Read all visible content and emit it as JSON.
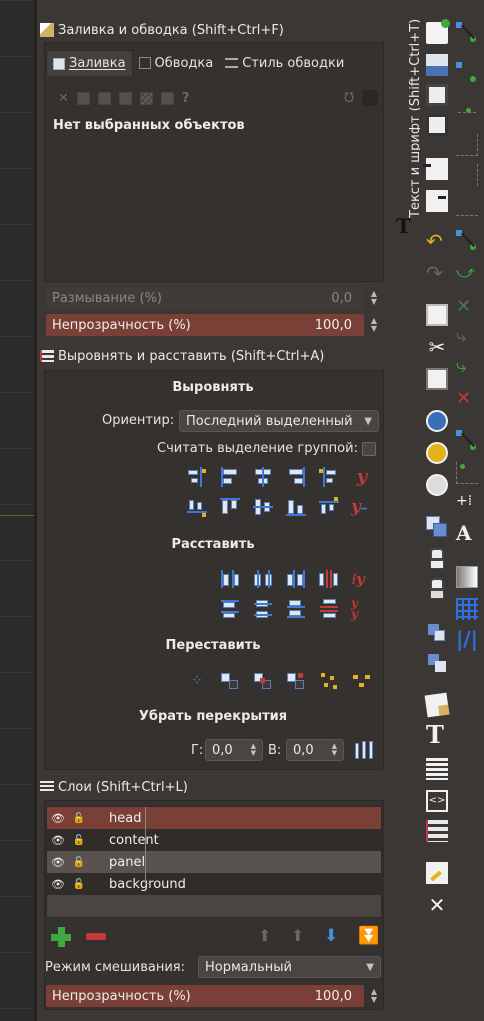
{
  "fill_stroke": {
    "title": "Заливка и обводка (Shift+Ctrl+F)",
    "tabs": [
      {
        "label": "Заливка",
        "underline": "З"
      },
      {
        "label": "Обводка",
        "underline": "б"
      },
      {
        "label": "Стиль обводки",
        "underline": "С"
      }
    ],
    "no_selection": "Нет выбранных объектов",
    "blur_label": "Размывание (%)",
    "blur_value": "0,0",
    "opacity_label": "Непрозрачность (%)",
    "opacity_value": "100,0"
  },
  "align": {
    "title": "Выровнять и расставить (Shift+Ctrl+A)",
    "align_head": "Выровнять",
    "relative_label": "Ориентир:",
    "relative_value": "Последний выделенный",
    "group_label": "Считать выделение группой:",
    "distribute_head": "Расставить",
    "rearrange_head": "Переставить",
    "overlap_head": "Убрать перекрытия",
    "h_label": "Г:",
    "h_value": "0,0",
    "v_label": "В:",
    "v_value": "0,0"
  },
  "layers": {
    "title": "Слои (Shift+Ctrl+L)",
    "items": [
      {
        "name": "head",
        "state": "sel"
      },
      {
        "name": "content",
        "state": "dark"
      },
      {
        "name": "panel",
        "state": "alt"
      },
      {
        "name": "background",
        "state": "dark"
      }
    ],
    "blend_label": "Режим смешивания:",
    "blend_value": "Нормальный",
    "opacity_label": "Непрозрачность (%)",
    "opacity_value": "100,0"
  },
  "vertical_tab": "Текст и шрифт (Shift+Ctrl+T)",
  "colors": {
    "accent_red": "#7a3f37",
    "panel_bg": "#3b3735"
  }
}
